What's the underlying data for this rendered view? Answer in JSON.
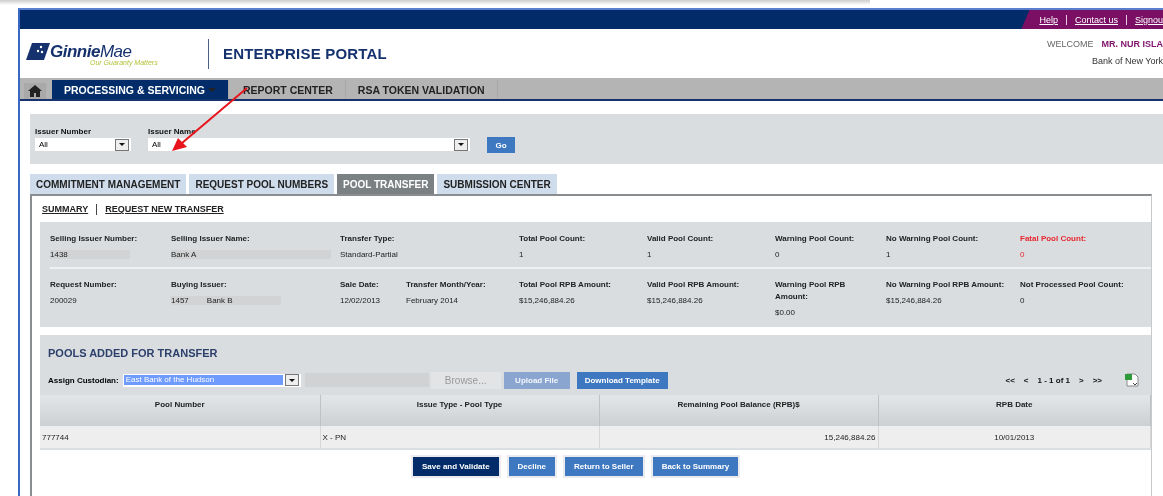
{
  "top_links": [
    "Help",
    "Contact us",
    "Signou"
  ],
  "logo": {
    "brand": "**Ginnie**Mae",
    "tagline": "Our Guaranty Matters"
  },
  "portal_title": "ENTERPRISE PORTAL",
  "welcome": {
    "label": "WELCOME",
    "user": "MR. NUR ISLA",
    "org": "Bank of New York"
  },
  "nav": [
    {
      "label": "PROCESSING & SERVICING",
      "selected": true,
      "has_menu": true
    },
    {
      "label": "REPORT CENTER",
      "selected": false,
      "has_menu": false
    },
    {
      "label": "RSA TOKEN VALIDATION",
      "selected": false,
      "has_menu": false
    }
  ],
  "filters": [
    {
      "label": "Issuer Number",
      "value": "All",
      "kind": "short"
    },
    {
      "label": "Issuer Name",
      "value": "All",
      "kind": "long"
    }
  ],
  "go_button": "Go",
  "tabs": [
    {
      "label": "COMMITMENT MANAGEMENT",
      "selected": false
    },
    {
      "label": "REQUEST POOL NUMBERS",
      "selected": false
    },
    {
      "label": "POOL TRANSFER",
      "selected": true
    },
    {
      "label": "SUBMISSION CENTER",
      "selected": false
    }
  ],
  "sub_links": [
    "SUMMARY",
    "REQUEST NEW TRANSFER"
  ],
  "summary_rows": [
    [
      {
        "label": "Selling Issuer Number:",
        "value": "1438",
        "shaded": true,
        "alert": false
      },
      {
        "label": "Selling Issuer Name:",
        "value": "Bank A",
        "shaded": true,
        "alert": false
      },
      {
        "label": "Transfer Type:",
        "value": "Standard-Partial",
        "shaded": false,
        "alert": false
      },
      {
        "label": "Total Pool Count:",
        "value": "1",
        "shaded": false,
        "alert": false
      },
      {
        "label": "Valid Pool Count:",
        "value": "1",
        "shaded": false,
        "alert": false
      },
      {
        "label": "Warning Pool Count:",
        "value": "0",
        "shaded": false,
        "alert": false
      },
      {
        "label": "No Warning Pool Count:",
        "value": "1",
        "shaded": false,
        "alert": false
      },
      {
        "label": "Fatal Pool Count:",
        "value": "0",
        "shaded": false,
        "alert": true
      }
    ],
    [
      {
        "label": "Request Number:",
        "value": "200029",
        "shaded": false,
        "alert": false
      },
      {
        "label": "Buying Issuer:",
        "value": "1457",
        "value_2": "Bank B",
        "shaded": true,
        "alert": false
      },
      {
        "label": "Sale Date:",
        "value": "12/02/2013",
        "shaded": false,
        "alert": false
      },
      {
        "label": "Transfer Month/Year:",
        "value": "February 2014",
        "shaded": false,
        "alert": false
      },
      {
        "label": "Total Pool RPB Amount:",
        "value": "$15,246,884.26",
        "shaded": false,
        "alert": false
      },
      {
        "label": "Valid Pool RPB Amount:",
        "value": "$15,246,884.26",
        "shaded": false,
        "alert": false
      },
      {
        "label": "Warning Pool RPB Amount:",
        "value": "$0.00",
        "shaded": false,
        "alert": false
      },
      {
        "label": "No Warning Pool RPB Amount:",
        "value": "$15,246,884.26",
        "shaded": false,
        "alert": false
      },
      {
        "label": "Not Processed Pool Count:",
        "value": "0",
        "shaded": false,
        "alert": false
      }
    ]
  ],
  "pools": {
    "title": "POOLS ADDED FOR TRANSFER",
    "custodian_label": "Assign Custodian:",
    "custodian_value": "East Bank of the Hudson",
    "browse": {
      "label": "Browse...",
      "disabled": true
    },
    "upload": {
      "label": "Upload File",
      "disabled": true
    },
    "download": {
      "label": "Download Template",
      "disabled": false
    },
    "pager": [
      "<<",
      "<",
      "1 - 1 of 1",
      ">",
      ">>"
    ],
    "columns": [
      "Pool Number",
      "Issue Type - Pool Type",
      "Remaining Pool Balance (RPB)$",
      "RPB Date"
    ],
    "rows": [
      [
        "777744",
        "X - PN",
        "15,246,884.26",
        "10/01/2013"
      ]
    ]
  },
  "actions": [
    {
      "label": "Save and Validate",
      "kind": "primary"
    },
    {
      "label": "Decline",
      "kind": "secondary"
    },
    {
      "label": "Return to Seller",
      "kind": "secondary"
    },
    {
      "label": "Back to Summary",
      "kind": "secondary"
    }
  ]
}
